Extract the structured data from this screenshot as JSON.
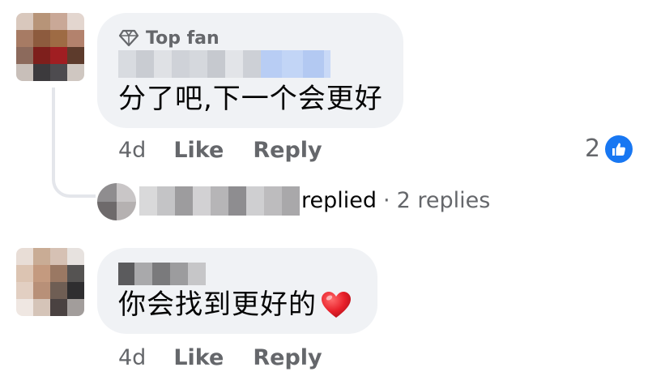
{
  "comments": [
    {
      "badge_label": "Top fan",
      "text": "分了吧,下一个会更好",
      "time": "4d",
      "like_label": "Like",
      "reply_label": "Reply",
      "reaction_count": "2",
      "reaction_icon": "like-icon",
      "thread": {
        "replied_label": "replied",
        "separator": "·",
        "replies_label": "2 replies"
      }
    },
    {
      "text": "你会找到更好的",
      "emoji_icon": "red-heart-icon",
      "time": "4d",
      "like_label": "Like",
      "reply_label": "Reply"
    }
  ],
  "colors": {
    "bubble": "#f0f2f5",
    "secondary_text": "#65676b",
    "like_blue": "#1877f2",
    "heart_red": "#e8202a"
  }
}
